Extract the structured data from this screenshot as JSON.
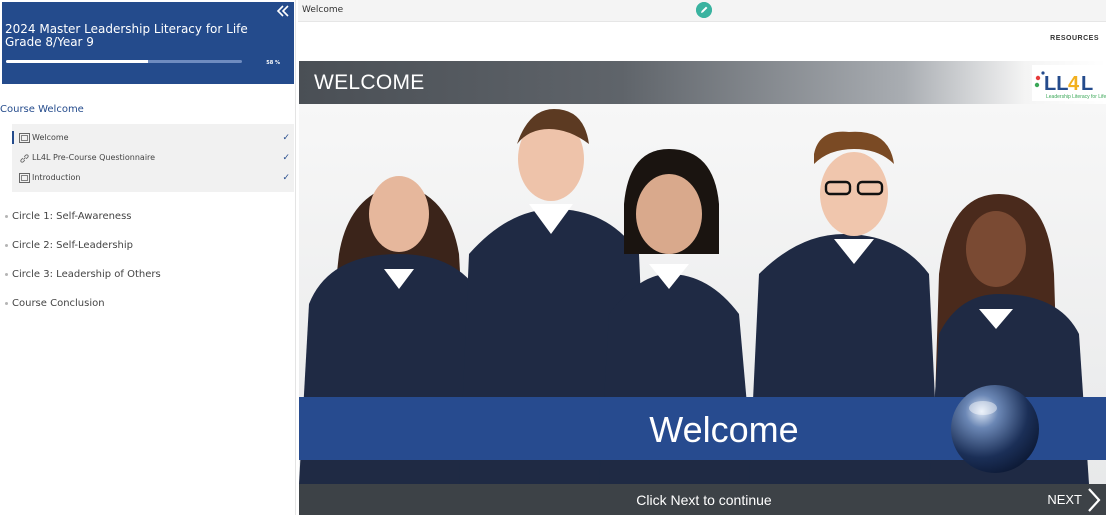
{
  "sidebar": {
    "course_title": "2024 Master Leadership Literacy for Life Grade 8/Year 9",
    "progress_percent": 60,
    "progress_label": "58 %",
    "sections": [
      {
        "label": "Course Welcome",
        "active": true
      },
      {
        "label": "Circle 1: Self-Awareness"
      },
      {
        "label": "Circle 2: Self-Leadership"
      },
      {
        "label": "Circle 3: Leadership of Others"
      },
      {
        "label": "Course Conclusion"
      }
    ],
    "lessons": [
      {
        "label": "Welcome",
        "icon": "slides-icon",
        "completed_mark": "✓"
      },
      {
        "label": "LL4L Pre-Course Questionnaire",
        "icon": "link-icon",
        "completed_mark": "✓"
      },
      {
        "label": "Introduction",
        "icon": "slides-icon",
        "completed_mark": "✓"
      }
    ]
  },
  "topbar": {
    "page_title": "Welcome",
    "resources_label": "RESOURCES"
  },
  "slide": {
    "header_title": "WELCOME",
    "logo_text": "LL4L",
    "banner_text": "Welcome",
    "footer_text": "Click Next to continue",
    "next_label": "NEXT"
  },
  "colors": {
    "brand_blue": "#244b8c",
    "edit_teal": "#3ab3a0",
    "footer_dark": "#3d4247"
  }
}
